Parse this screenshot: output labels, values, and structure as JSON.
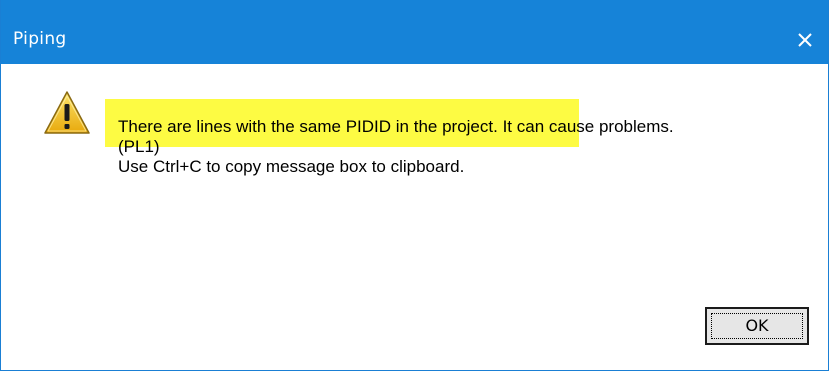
{
  "dialog": {
    "title": "Piping",
    "close_icon": "close-icon",
    "warning_icon": "warning-triangle-icon",
    "message": {
      "highlighted": "There are lines with the same PIDID in the project.",
      "rest_line1": " It can cause problems.",
      "line2": "(PL1)",
      "line3": "Use Ctrl+C to copy message box to clipboard."
    },
    "ok_label": "OK"
  },
  "colors": {
    "titlebar": "#1683d8",
    "highlight": "#fdfb43",
    "button_face": "#e6e6e6",
    "warning_fill": "#f5c518"
  }
}
